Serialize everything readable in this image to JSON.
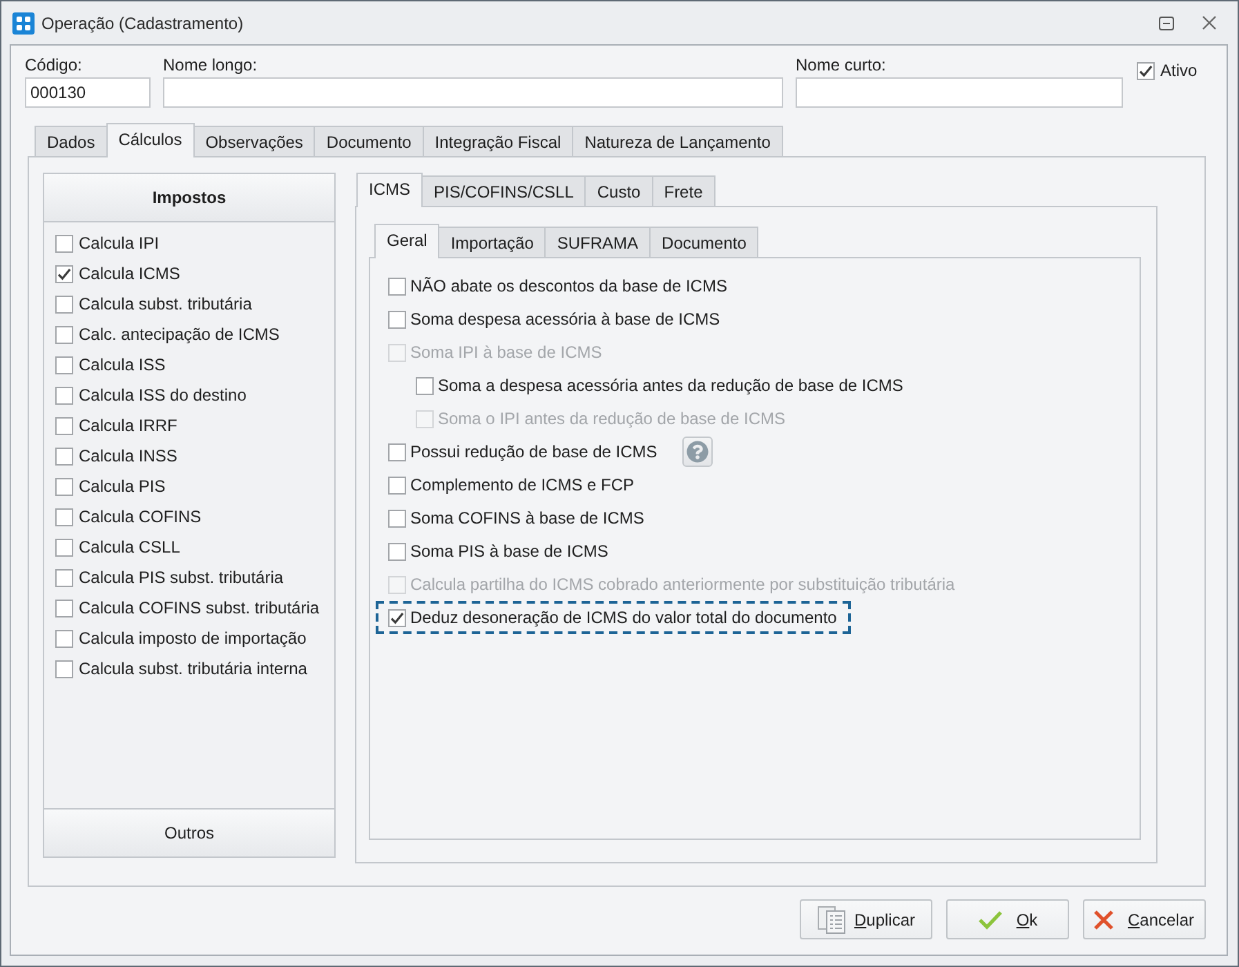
{
  "window": {
    "title": "Operação (Cadastramento)"
  },
  "fields": [
    {
      "label": "Código:",
      "value": "000130"
    },
    {
      "label": "Nome longo:"
    },
    {
      "label": "Nome curto:"
    }
  ],
  "active": {
    "label": "Ativo",
    "checked": true
  },
  "tabs": [
    {
      "label": "Dados",
      "selected": false
    },
    {
      "label": "Cálculos",
      "selected": true
    },
    {
      "label": "Observações",
      "selected": false
    },
    {
      "label": "Documento",
      "selected": false
    },
    {
      "label": "Integração Fiscal",
      "selected": false
    },
    {
      "label": "Natureza de Lançamento",
      "selected": false
    }
  ],
  "taxes": {
    "title": "Impostos",
    "items": [
      {
        "label": "Calcula IPI",
        "checked": false
      },
      {
        "label": "Calcula ICMS",
        "checked": true
      },
      {
        "label": "Calcula subst. tributária",
        "checked": false
      },
      {
        "label": "Calc. antecipação de ICMS",
        "checked": false
      },
      {
        "label": "Calcula ISS",
        "checked": false
      },
      {
        "label": "Calcula ISS do destino",
        "checked": false
      },
      {
        "label": "Calcula IRRF",
        "checked": false
      },
      {
        "label": "Calcula INSS",
        "checked": false
      },
      {
        "label": "Calcula PIS",
        "checked": false
      },
      {
        "label": "Calcula COFINS",
        "checked": false
      },
      {
        "label": "Calcula CSLL",
        "checked": false
      },
      {
        "label": "Calcula PIS subst. tributária",
        "checked": false
      },
      {
        "label": "Calcula COFINS subst. tributária",
        "checked": false
      },
      {
        "label": "Calcula imposto de importação",
        "checked": false
      },
      {
        "label": "Calcula subst. tributária interna",
        "checked": false
      }
    ],
    "footer": "Outros"
  },
  "icms_tabs": [
    {
      "label": "ICMS",
      "selected": true
    },
    {
      "label": "PIS/COFINS/CSLL",
      "selected": false
    },
    {
      "label": "Custo",
      "selected": false
    },
    {
      "label": "Frete",
      "selected": false
    }
  ],
  "icms_subtabs": [
    {
      "label": "Geral",
      "selected": true
    },
    {
      "label": "Importação",
      "selected": false
    },
    {
      "label": "SUFRAMA",
      "selected": false
    },
    {
      "label": "Documento",
      "selected": false
    }
  ],
  "icms_options": [
    {
      "label": "NÃO abate os descontos da base de ICMS",
      "kind": "plain",
      "checked": false,
      "disabled": false,
      "focused": false
    },
    {
      "label": "Soma despesa acessória à base de ICMS",
      "kind": "plain",
      "checked": false,
      "disabled": false,
      "focused": false
    },
    {
      "label": "Soma IPI à base de ICMS",
      "kind": "plain",
      "checked": false,
      "disabled": true,
      "focused": false,
      "children": [
        {
          "label": "Soma a despesa acessória antes da redução de base de ICMS",
          "kind": "plain",
          "checked": false,
          "disabled": false,
          "focused": false
        },
        {
          "label": "Soma o IPI antes da redução de base de ICMS",
          "kind": "plain",
          "checked": false,
          "disabled": true,
          "focused": false
        }
      ]
    },
    {
      "label": "Possui redução de base de ICMS",
      "kind": "help",
      "checked": false,
      "disabled": false,
      "focused": false
    },
    {
      "label": "Complemento de ICMS e FCP",
      "kind": "plain",
      "checked": false,
      "disabled": false,
      "focused": false
    },
    {
      "label": "Soma COFINS à base de ICMS",
      "kind": "plain",
      "checked": false,
      "disabled": false,
      "focused": false
    },
    {
      "label": "Soma PIS à base de ICMS",
      "kind": "plain",
      "checked": false,
      "disabled": false,
      "focused": false
    },
    {
      "label": "Calcula partilha do ICMS cobrado anteriormente por substituição tributária",
      "kind": "plain",
      "checked": false,
      "disabled": true,
      "focused": false
    },
    {
      "label": "Deduz desoneração de ICMS do valor total do documento",
      "kind": "plain",
      "checked": true,
      "disabled": false,
      "focused": true
    }
  ],
  "buttons": [
    {
      "label": "Duplicar",
      "kind": "duplicate"
    },
    {
      "label": "Ok",
      "kind": "ok"
    },
    {
      "label": "Cancelar",
      "kind": "cancel"
    }
  ]
}
